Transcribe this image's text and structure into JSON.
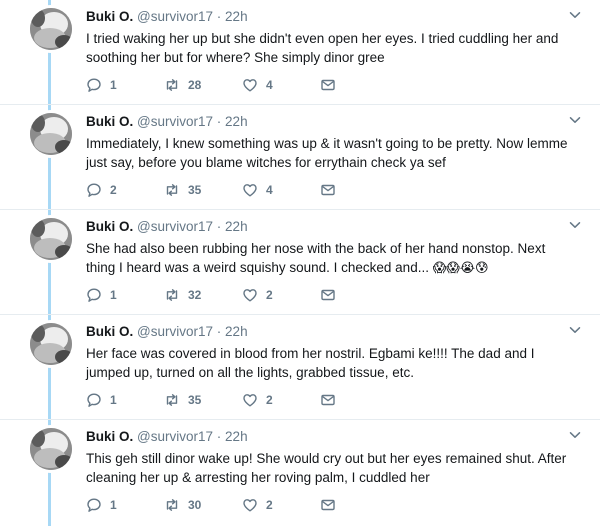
{
  "colors": {
    "thread_line": "#a7d8f5",
    "secondary_text": "#657786",
    "primary_text": "#14171a"
  },
  "icons": {
    "reply": "reply-icon",
    "retweet": "retweet-icon",
    "like": "heart-icon",
    "dm": "envelope-icon",
    "menu": "chevron-down-icon"
  },
  "tweets": [
    {
      "name": "Buki O.",
      "handle": "@survivor17",
      "dot": "·",
      "time": "22h",
      "text": "I tried waking her up but she didn't even open her eyes. I tried cuddling her and soothing her but for where? She simply dinor gree",
      "emoji": "",
      "replies": "1",
      "retweets": "28",
      "likes": "4"
    },
    {
      "name": "Buki O.",
      "handle": "@survivor17",
      "dot": "·",
      "time": "22h",
      "text": "Immediately, I knew something was up & it wasn't going to be pretty. Now lemme just say, before you blame witches for errythain check ya sef",
      "emoji": "",
      "replies": "2",
      "retweets": "35",
      "likes": "4"
    },
    {
      "name": "Buki O.",
      "handle": "@survivor17",
      "dot": "·",
      "time": "22h",
      "text": "She had also been rubbing her nose with the back of her hand nonstop. Next thing I heard was a weird squishy sound. I checked and...",
      "emoji": "😱😱😭😰",
      "replies": "1",
      "retweets": "32",
      "likes": "2"
    },
    {
      "name": "Buki O.",
      "handle": "@survivor17",
      "dot": "·",
      "time": "22h",
      "text": "Her face was covered in blood from her nostril. Egbami ke!!!! The dad and I jumped up, turned on all the lights, grabbed tissue, etc.",
      "emoji": "",
      "replies": "1",
      "retweets": "35",
      "likes": "2"
    },
    {
      "name": "Buki O.",
      "handle": "@survivor17",
      "dot": "·",
      "time": "22h",
      "text": "This geh still dinor wake up! She would cry out but her eyes remained shut. After cleaning her up & arresting her roving palm, I cuddled her",
      "emoji": "",
      "replies": "1",
      "retweets": "30",
      "likes": "2"
    }
  ]
}
